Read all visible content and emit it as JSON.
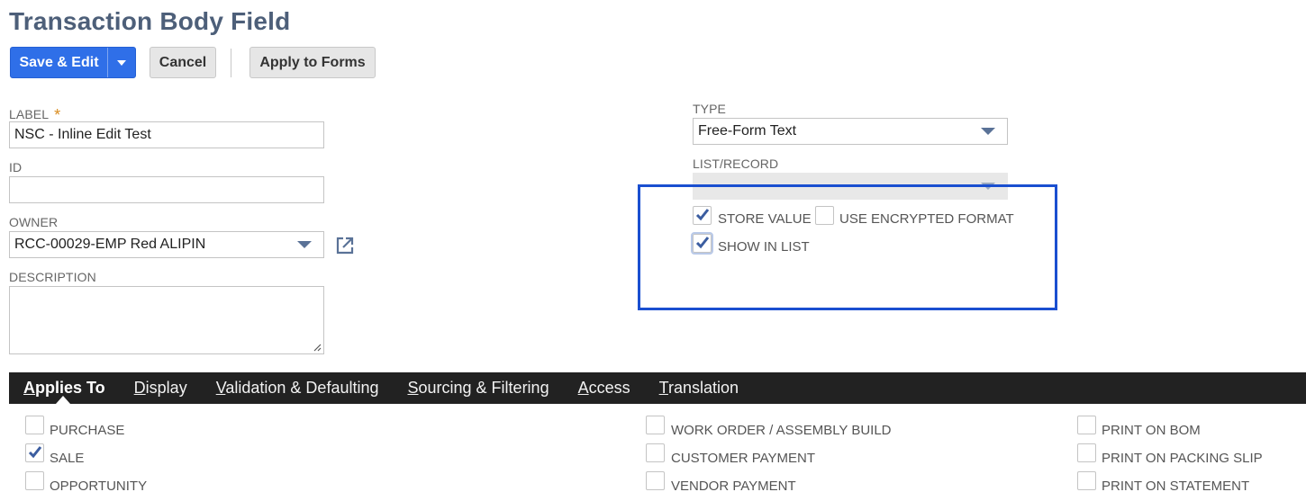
{
  "page": {
    "title": "Transaction Body Field"
  },
  "toolbar": {
    "save_edit_label": "Save & Edit",
    "cancel_label": "Cancel",
    "apply_label": "Apply to Forms"
  },
  "form": {
    "label": {
      "label": "LABEL",
      "required_mark": "*",
      "value": "NSC - Inline Edit Test"
    },
    "id": {
      "label": "ID",
      "value": ""
    },
    "owner": {
      "label": "OWNER",
      "value": "RCC-00029-EMP Red  ALIPIN"
    },
    "description": {
      "label": "DESCRIPTION",
      "value": ""
    },
    "type": {
      "label": "TYPE",
      "value": "Free-Form Text"
    },
    "list_record": {
      "label": "LIST/RECORD",
      "value": ""
    },
    "store_value": {
      "label": "STORE VALUE",
      "checked": true
    },
    "use_encrypted_format": {
      "label": "USE ENCRYPTED FORMAT",
      "checked": false
    },
    "show_in_list": {
      "label": "SHOW IN LIST",
      "checked": true
    }
  },
  "tabs": [
    {
      "first": "A",
      "rest": "pplies To",
      "active": true
    },
    {
      "first": "D",
      "rest": "isplay",
      "active": false
    },
    {
      "first": "V",
      "rest": "alidation & Defaulting",
      "active": false
    },
    {
      "first": "S",
      "rest": "ourcing & Filtering",
      "active": false
    },
    {
      "first": "A",
      "rest": "ccess",
      "active": false
    },
    {
      "first": "T",
      "rest": "ranslation",
      "active": false
    }
  ],
  "applies_to": {
    "col1": [
      {
        "label": "PURCHASE",
        "checked": false
      },
      {
        "label": "SALE",
        "checked": true
      },
      {
        "label": "OPPORTUNITY",
        "checked": false
      }
    ],
    "col2": [
      {
        "label": "WORK ORDER / ASSEMBLY BUILD",
        "checked": false
      },
      {
        "label": "CUSTOMER PAYMENT",
        "checked": false
      },
      {
        "label": "VENDOR PAYMENT",
        "checked": false
      }
    ],
    "col3": [
      {
        "label": "PRINT ON BOM",
        "checked": false
      },
      {
        "label": "PRINT ON PACKING SLIP",
        "checked": false
      },
      {
        "label": "PRINT ON STATEMENT",
        "checked": false
      }
    ]
  },
  "colors": {
    "primary": "#2f6fe8",
    "title": "#4d5f79",
    "highlight": "#1a4fd0",
    "tabbar": "#222222"
  }
}
